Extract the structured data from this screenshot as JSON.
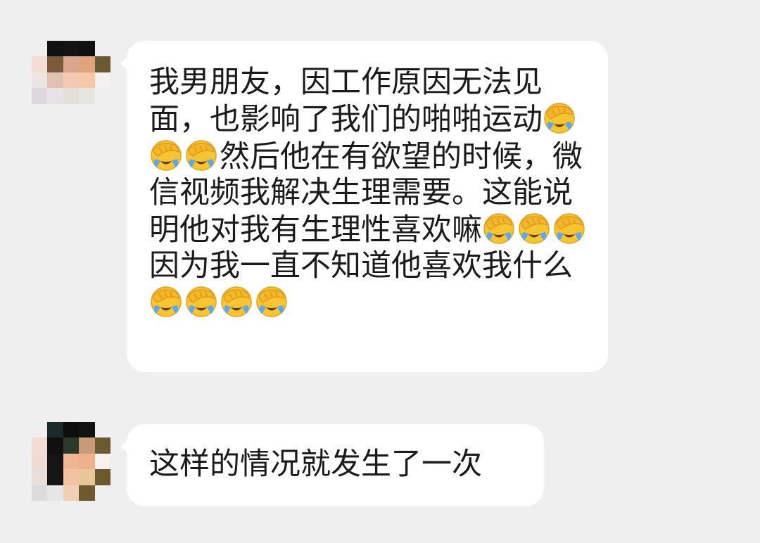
{
  "messages": [
    {
      "id": "m1",
      "avatar": {
        "icon": "pixelated-avatar-icon",
        "pixels": [
          [
            "#efefef",
            "#111111",
            "#141414",
            "#101010",
            "#efefef"
          ],
          [
            "#f1dfd6",
            "#7b5a3a",
            "#d9a68e",
            "#e0a37c",
            "#6a5a33"
          ],
          [
            "#ece6e2",
            "#e0c2b3",
            "#f3c9b5",
            "#f5c8a8",
            "#f4f0ee"
          ],
          [
            "#ded8de",
            "#e8e2e6",
            "#e4e0d8",
            "#e6e6e0",
            "#efefef"
          ],
          [
            "#efefef",
            "#efefef",
            "#efefef",
            "#efefef",
            "#efefef"
          ]
        ]
      },
      "segments": [
        {
          "type": "text",
          "value": "我男朋友，因工作原因无法见面，也影响了我们的啪啪运动"
        },
        {
          "type": "emoji",
          "icon": "face-palm-crying-emoji-icon"
        },
        {
          "type": "emoji",
          "icon": "face-palm-crying-emoji-icon"
        },
        {
          "type": "emoji",
          "icon": "face-palm-crying-emoji-icon"
        },
        {
          "type": "text",
          "value": "然后他在有欲望的时候，微信视频我解决生理需要。这能说明他对我有生理性喜欢嘛"
        },
        {
          "type": "emoji",
          "icon": "face-palm-crying-emoji-icon"
        },
        {
          "type": "emoji",
          "icon": "face-palm-crying-emoji-icon"
        },
        {
          "type": "emoji",
          "icon": "face-palm-crying-emoji-icon"
        },
        {
          "type": "text",
          "value": "因为我一直不知道他喜欢我什么"
        },
        {
          "type": "emoji",
          "icon": "face-palm-crying-emoji-icon"
        },
        {
          "type": "emoji",
          "icon": "face-palm-crying-emoji-icon"
        },
        {
          "type": "emoji",
          "icon": "face-palm-crying-emoji-icon"
        },
        {
          "type": "emoji",
          "icon": "face-palm-crying-emoji-icon"
        }
      ]
    },
    {
      "id": "m2",
      "avatar": {
        "icon": "pixelated-avatar-icon",
        "pixels": [
          [
            "#efefef",
            "#1c2a2c",
            "#0e0e0e",
            "#121212",
            "#efefef"
          ],
          [
            "#f2dcd4",
            "#101010",
            "#2c3a2a",
            "#c89a7a",
            "#6a5a30"
          ],
          [
            "#efdcd2",
            "#151515",
            "#f1b592",
            "#efb08c",
            "#f6f2ee"
          ],
          [
            "#e8dedc",
            "#151515",
            "#f2c2a2",
            "#e8c69a",
            "#6c5a2e"
          ],
          [
            "#dcdcdc",
            "#e6e6e6",
            "#efcfb6",
            "#6e5a2c",
            "#efefef"
          ]
        ]
      },
      "segments": [
        {
          "type": "text",
          "value": "这样的情况就发生了一次"
        }
      ]
    }
  ],
  "colors": {
    "background": "#efefef",
    "bubble": "#ffffff",
    "text": "#1b1b1b"
  }
}
